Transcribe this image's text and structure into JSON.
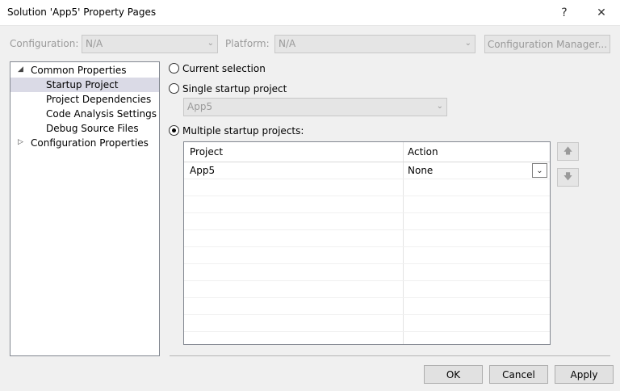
{
  "window": {
    "title": "Solution 'App5' Property Pages",
    "help_glyph": "?",
    "close_glyph": "✕"
  },
  "toolbar": {
    "configuration_label": "Configuration:",
    "configuration_value": "N/A",
    "platform_label": "Platform:",
    "platform_value": "N/A",
    "config_manager_label": "Configuration Manager..."
  },
  "tree": {
    "items": [
      {
        "label": "Common Properties",
        "expander": "◢"
      },
      {
        "label": "Startup Project"
      },
      {
        "label": "Project Dependencies"
      },
      {
        "label": "Code Analysis Settings"
      },
      {
        "label": "Debug Source Files"
      },
      {
        "label": "Configuration Properties",
        "expander": "▷"
      }
    ],
    "selected": "Startup Project"
  },
  "startup": {
    "current_selection_label": "Current selection",
    "single_label": "Single startup project",
    "single_value": "App5",
    "multiple_label": "Multiple startup projects:",
    "selected_option": "multiple"
  },
  "grid": {
    "columns": [
      "Project",
      "Action"
    ],
    "rows": [
      {
        "project": "App5",
        "action": "None"
      }
    ]
  },
  "side_buttons": {
    "up_icon": "🡅",
    "down_icon": "🡇"
  },
  "footer": {
    "ok_label": "OK",
    "cancel_label": "Cancel",
    "apply_label": "Apply"
  }
}
